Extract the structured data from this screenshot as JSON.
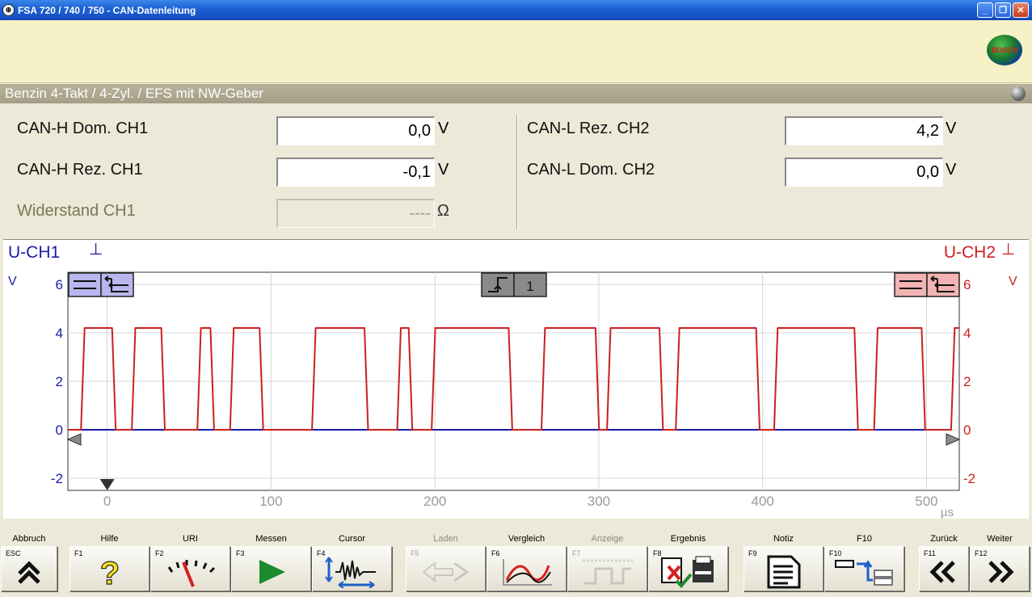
{
  "window": {
    "title": "FSA 720 / 740 / 750 - CAN-Datenleitung",
    "app_icon": "bosch-app-icon",
    "buttons": {
      "minimize": "_",
      "maximize": "❐",
      "close": "✕"
    }
  },
  "header": {
    "logo_text": "BOSCH"
  },
  "subtitle": "Benzin 4-Takt  /  4-Zyl.  /  EFS mit NW-Geber",
  "measurements": {
    "left": [
      {
        "label": "CAN-H Dom. CH1",
        "value": "0,0",
        "unit": "V",
        "enabled": true
      },
      {
        "label": "CAN-H Rez. CH1",
        "value": "-0,1",
        "unit": "V",
        "enabled": true
      },
      {
        "label": "Widerstand CH1",
        "value": "----",
        "unit": "Ω",
        "enabled": false
      }
    ],
    "right": [
      {
        "label": "CAN-L Rez. CH2",
        "value": "4,2",
        "unit": "V",
        "enabled": true
      },
      {
        "label": "CAN-L Dom. CH2",
        "value": "0,0",
        "unit": "V",
        "enabled": true
      }
    ]
  },
  "chart_data": {
    "type": "line",
    "left_axis": {
      "title": "U-CH1",
      "symbol": "⊥",
      "unit": "V",
      "ticks": [
        6,
        4,
        2,
        0,
        -2
      ],
      "color": "#1a1aa8"
    },
    "right_axis": {
      "title": "U-CH2",
      "symbol": "⊥",
      "unit": "V",
      "ticks": [
        6,
        4,
        2,
        0,
        -2
      ],
      "color": "#cc1f1f"
    },
    "x_axis": {
      "unit": "µs",
      "ticks": [
        0,
        100,
        200,
        300,
        400,
        500
      ],
      "range": [
        -24,
        520
      ]
    },
    "y_range": [
      -2.5,
      6.5
    ],
    "trigger_label": "1",
    "series": [
      {
        "color": "#1a1aa8",
        "pulses": []
      },
      {
        "color": "#cc1f1f",
        "high": 4.2,
        "low": 0,
        "pulses": [
          [
            -16,
            3
          ],
          [
            15,
            33
          ],
          [
            55,
            63
          ],
          [
            75,
            93
          ],
          [
            125,
            157
          ],
          [
            177,
            184
          ],
          [
            198,
            245
          ],
          [
            265,
            298
          ],
          [
            305,
            337
          ],
          [
            347,
            396
          ],
          [
            407,
            456
          ],
          [
            468,
            497
          ],
          [
            515,
            520
          ]
        ]
      }
    ]
  },
  "fkeys": [
    {
      "label": "Abbruch",
      "code": "ESC",
      "icon": "double-chevron-up-icon",
      "enabled": true
    },
    {
      "label": "Hilfe",
      "code": "F1",
      "icon": "question-mark-icon",
      "enabled": true
    },
    {
      "label": "URI",
      "code": "F2",
      "icon": "gauge-needle-icon",
      "enabled": true
    },
    {
      "label": "Messen",
      "code": "F3",
      "icon": "play-icon",
      "enabled": true
    },
    {
      "label": "Cursor",
      "code": "F4",
      "icon": "cursor-waveform-icon",
      "enabled": true
    },
    {
      "label": "Laden",
      "code": "F5",
      "icon": "load-arrow-icon",
      "enabled": false
    },
    {
      "label": "Vergleich",
      "code": "F6",
      "icon": "compare-curve-icon",
      "enabled": true
    },
    {
      "label": "Anzeige",
      "code": "F7",
      "icon": "display-signal-icon",
      "enabled": false
    },
    {
      "label": "Ergebnis",
      "code": "F8",
      "icon": "result-print-icon",
      "enabled": true
    },
    {
      "label": "Notiz",
      "code": "F9",
      "icon": "note-document-icon",
      "enabled": true
    },
    {
      "label": "F10",
      "code": "F10",
      "icon": "layout-switch-icon",
      "enabled": true
    },
    {
      "label": "Zurück",
      "code": "F11",
      "icon": "double-chevron-left-icon",
      "enabled": true
    },
    {
      "label": "Weiter",
      "code": "F12",
      "icon": "double-chevron-right-icon",
      "enabled": true
    }
  ]
}
